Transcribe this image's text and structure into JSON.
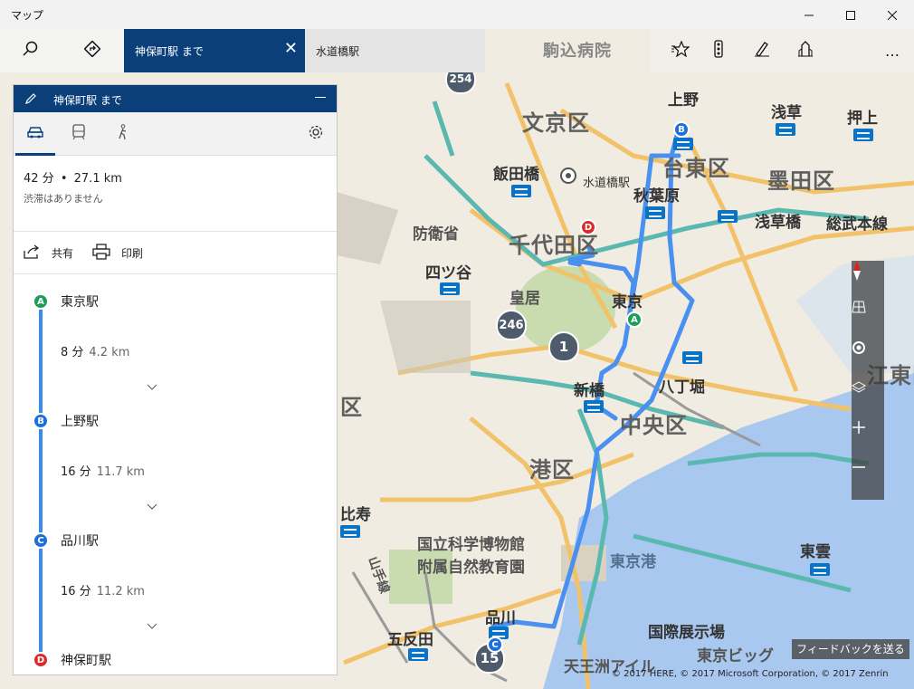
{
  "app": {
    "title": "マップ"
  },
  "window": {
    "minimize_icon": "minimize-icon",
    "maximize_icon": "maximize-icon",
    "close_icon": "close-icon"
  },
  "toolbar": {
    "search_icon": "search-icon",
    "directions_icon": "directions-icon",
    "tabs": [
      {
        "label": "神保町駅 まで",
        "active": true
      },
      {
        "label": "水道橋駅",
        "active": false
      }
    ],
    "right_icons": [
      "favorites-icon",
      "traffic-icon",
      "ink-icon",
      "3d-cities-icon",
      "more-icon"
    ],
    "more_label": "…"
  },
  "panel": {
    "title": "神保町駅 まで",
    "modes": [
      "car-icon",
      "transit-icon",
      "walk-icon"
    ],
    "active_mode": "car",
    "settings_icon": "settings-icon",
    "summary": {
      "duration": "42 分",
      "separator": "•",
      "distance": "27.1 km",
      "traffic": "渋滞はありません"
    },
    "actions": {
      "share": "共有",
      "print": "印刷"
    },
    "stops": [
      {
        "letter": "A",
        "name": "東京駅",
        "color": "#1a9e5a"
      },
      {
        "letter": "B",
        "name": "上野駅",
        "color": "#1d6fdc"
      },
      {
        "letter": "C",
        "name": "品川駅",
        "color": "#1d6fdc"
      },
      {
        "letter": "D",
        "name": "神保町駅",
        "color": "#d92b2b"
      }
    ],
    "legs": [
      {
        "time": "8 分",
        "km": "4.2 km"
      },
      {
        "time": "16 分",
        "km": "11.7 km"
      },
      {
        "time": "16 分",
        "km": "11.2 km"
      }
    ]
  },
  "map": {
    "labels": {
      "bunkyo": "文京区",
      "taito": "台東区",
      "sumida": "墨田区",
      "chiyoda": "千代田区",
      "chuo": "中央区",
      "minato": "港区",
      "koto": "江東区",
      "shinagawa_ku": "区",
      "ueno": "上野",
      "asakusa": "浅草",
      "oshiage": "押上",
      "iidabashi": "飯田橋",
      "suidobashi": "水道橋駅",
      "akihabara": "秋葉原",
      "asakusabashi": "浅草橋",
      "ryogoku_line": "総武本線",
      "ichigaya": "四ツ谷",
      "boueisho": "防衛省",
      "kokyo": "皇居",
      "tokyo": "東京",
      "shinbashi": "新橋",
      "hatchobori": "八丁堀",
      "ebisu": "比寿",
      "museum1": "国立科学博物館",
      "museum2": "附属自然教育園",
      "yamanote": "山手線",
      "tokyoko": "東京港",
      "shinagawa": "品川",
      "gotanda": "五反田",
      "higashikumo": "東雲",
      "kokusai": "国際展示場",
      "tennozu": "天王洲アイル",
      "tokyobig": "東京ビッグ",
      "komagome": "駒込病院"
    },
    "shields": [
      "246",
      "1",
      "15",
      "254"
    ],
    "pins": {
      "A": "A",
      "B": "B",
      "C": "C",
      "D": "D"
    },
    "feedback": "フィードバックを送る",
    "copyright": "© 2017 HERE, © 2017 Microsoft Corporation, © 2017 Zenrin",
    "controls": [
      "compass-icon",
      "tilt-icon",
      "locate-icon",
      "layers-icon",
      "zoom-in-icon",
      "zoom-out-icon"
    ],
    "route_color": "#4a90f0"
  }
}
